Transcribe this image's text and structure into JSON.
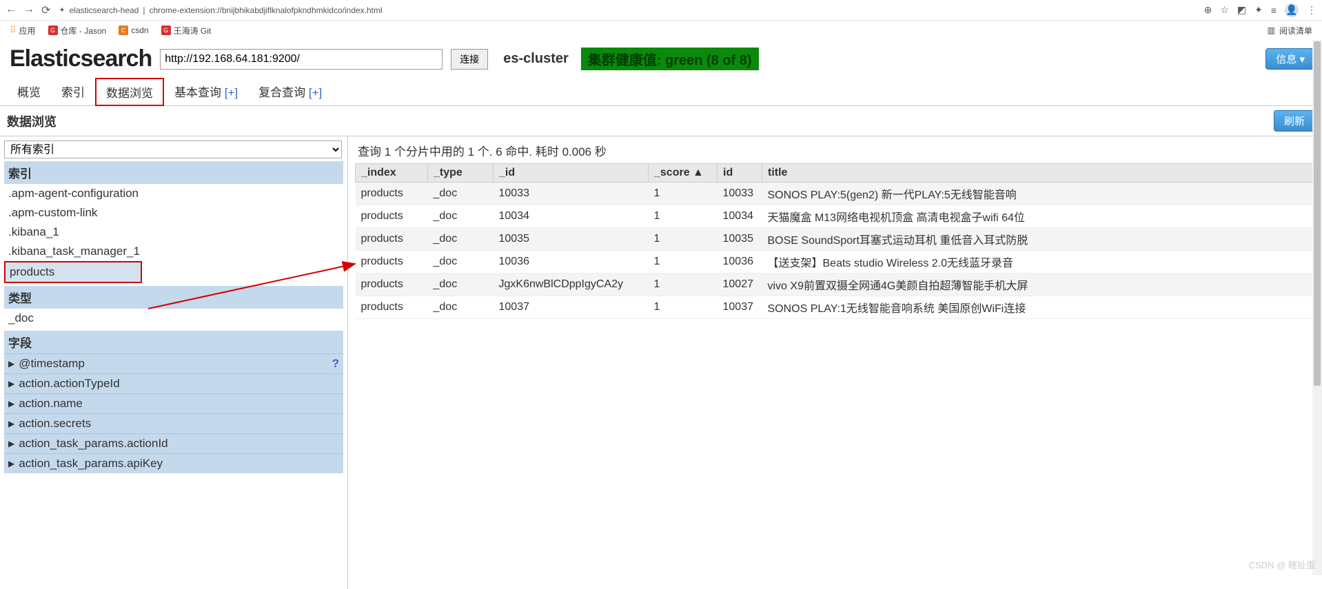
{
  "browser": {
    "page_name": "elasticsearch-head",
    "url": "chrome-extension://bnijbhikabdjiflknalofpkndhmkidco/index.html",
    "reading_list": "阅读清单"
  },
  "bookmarks": {
    "apps": "应用",
    "b1": "仓库 - Jason",
    "b2": "csdn",
    "b3": "王海涛 Git"
  },
  "header": {
    "logo": "Elasticsearch",
    "conn_url": "http://192.168.64.181:9200/",
    "connect": "连接",
    "cluster": "es-cluster",
    "health": "集群健康值: green (8 of 8)",
    "info": "信息 ▾"
  },
  "tabs": {
    "overview": "概览",
    "indices": "索引",
    "browse": "数据浏览",
    "basic_query": "基本查询",
    "compound_query": "复合查询",
    "plus": "[+]"
  },
  "subheader": {
    "title": "数据浏览",
    "refresh": "刷新"
  },
  "sidebar": {
    "select_value": "所有索引",
    "label_index": "索引",
    "indices": [
      ".apm-agent-configuration",
      ".apm-custom-link",
      ".kibana_1",
      ".kibana_task_manager_1",
      "products"
    ],
    "label_type": "类型",
    "types": [
      "_doc"
    ],
    "label_fields": "字段",
    "fields": [
      "@timestamp",
      "action.actionTypeId",
      "action.name",
      "action.secrets",
      "action_task_params.actionId",
      "action_task_params.apiKey"
    ]
  },
  "results": {
    "summary": "查询 1 个分片中用的 1 个. 6 命中. 耗时 0.006 秒",
    "columns": [
      "_index",
      "_type",
      "_id",
      "_score ▲",
      "id",
      "title"
    ],
    "rows": [
      {
        "index": "products",
        "type": "_doc",
        "id": "10033",
        "score": "1",
        "id2": "10033",
        "title": "SONOS PLAY:5(gen2) 新一代PLAY:5无线智能音响"
      },
      {
        "index": "products",
        "type": "_doc",
        "id": "10034",
        "score": "1",
        "id2": "10034",
        "title": "天猫魔盒 M13网络电视机顶盒 高清电视盒子wifi 64位"
      },
      {
        "index": "products",
        "type": "_doc",
        "id": "10035",
        "score": "1",
        "id2": "10035",
        "title": "BOSE SoundSport耳塞式运动耳机 重低音入耳式防脱"
      },
      {
        "index": "products",
        "type": "_doc",
        "id": "10036",
        "score": "1",
        "id2": "10036",
        "title": "【送支架】Beats studio Wireless 2.0无线蓝牙录音"
      },
      {
        "index": "products",
        "type": "_doc",
        "id": "JgxK6nwBlCDppIgyCA2y",
        "score": "1",
        "id2": "10027",
        "title": "vivo X9前置双摄全网通4G美颜自拍超薄智能手机大屏"
      },
      {
        "index": "products",
        "type": "_doc",
        "id": "10037",
        "score": "1",
        "id2": "10037",
        "title": "SONOS PLAY:1无线智能音响系统 美国原创WiFi连接"
      }
    ]
  },
  "watermark": "CSDN @ 瞎扯蛋"
}
